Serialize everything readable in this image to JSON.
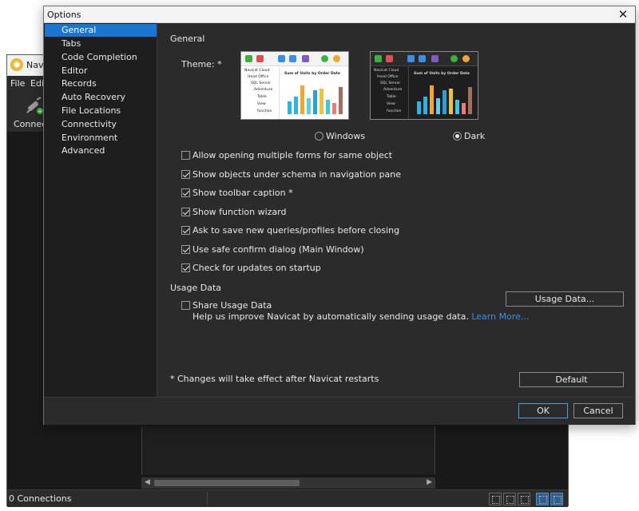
{
  "background_window": {
    "title": "Navi",
    "menu": [
      "File",
      "Edit"
    ],
    "toolbar": {
      "connection_label": "Connect"
    },
    "status": "0 Connections"
  },
  "dialog": {
    "title": "Options",
    "close_glyph": "✕",
    "sidebar": {
      "items": [
        {
          "label": "General",
          "selected": true
        },
        {
          "label": "Tabs"
        },
        {
          "label": "Code Completion"
        },
        {
          "label": "Editor"
        },
        {
          "label": "Records"
        },
        {
          "label": "Auto Recovery"
        },
        {
          "label": "File Locations"
        },
        {
          "label": "Connectivity"
        },
        {
          "label": "Environment"
        },
        {
          "label": "Advanced"
        }
      ]
    },
    "general": {
      "heading": "General",
      "theme_label": "Theme: *",
      "theme_preview": {
        "tree": [
          "Navicat Cloud",
          "Head Office",
          "SQL Server",
          "Adventure",
          "Table",
          "View",
          "function"
        ],
        "chart_title": "Sum of Units by Order Date"
      },
      "themes": [
        {
          "label": "Windows",
          "selected": false
        },
        {
          "label": "Dark",
          "selected": true
        }
      ],
      "options": [
        {
          "label": "Allow opening multiple forms for same object",
          "checked": false
        },
        {
          "label": "Show objects under schema in navigation pane",
          "checked": true
        },
        {
          "label": "Show toolbar caption *",
          "checked": true
        },
        {
          "label": "Show function wizard",
          "checked": true
        },
        {
          "label": "Ask to save new queries/profiles before closing",
          "checked": true
        },
        {
          "label": "Use safe confirm dialog (Main Window)",
          "checked": true
        },
        {
          "label": "Check for updates on startup",
          "checked": true
        }
      ]
    },
    "usage": {
      "heading": "Usage Data",
      "share_label": "Share Usage Data",
      "share_checked": false,
      "help_text": "Help us improve Navicat by automatically sending usage data.",
      "learn_more": "Learn More...",
      "button": "Usage Data..."
    },
    "restart_note": "* Changes will take effect after Navicat restarts",
    "default_button": "Default",
    "ok_button": "OK",
    "cancel_button": "Cancel"
  },
  "colors": {
    "accent": "#1976d2",
    "dialog_bg": "#2b2b2b",
    "link": "#3a8ee6",
    "bar_colors": [
      "#2bb3e6",
      "#f0a830",
      "#5ad1e8",
      "#f0c040",
      "#2b9fd8",
      "#f07878",
      "#3cc8e0",
      "#a07060"
    ]
  }
}
